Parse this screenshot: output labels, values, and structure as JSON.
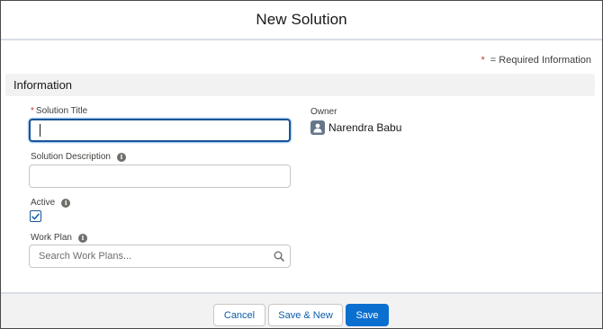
{
  "modal": {
    "title": "New Solution"
  },
  "required_legend": {
    "star": "*",
    "text": "= Required Information"
  },
  "section": {
    "title": "Information"
  },
  "fields": {
    "solution_title": {
      "label": "Solution Title",
      "required_mark": "*",
      "value": ""
    },
    "solution_description": {
      "label": "Solution Description",
      "value": ""
    },
    "active": {
      "label": "Active",
      "checked": true
    },
    "work_plan": {
      "label": "Work Plan",
      "placeholder": "Search Work Plans..."
    }
  },
  "owner": {
    "label": "Owner",
    "name": "Narendra Babu"
  },
  "footer": {
    "cancel_label": "Cancel",
    "save_new_label": "Save & New",
    "save_label": "Save"
  },
  "icons": {
    "info": "info-icon",
    "search": "search-icon",
    "check": "check-icon",
    "avatar": "user-avatar-icon"
  },
  "colors": {
    "brand": "#0b6fd0",
    "required": "#c23934",
    "focus": "#1b5297"
  }
}
